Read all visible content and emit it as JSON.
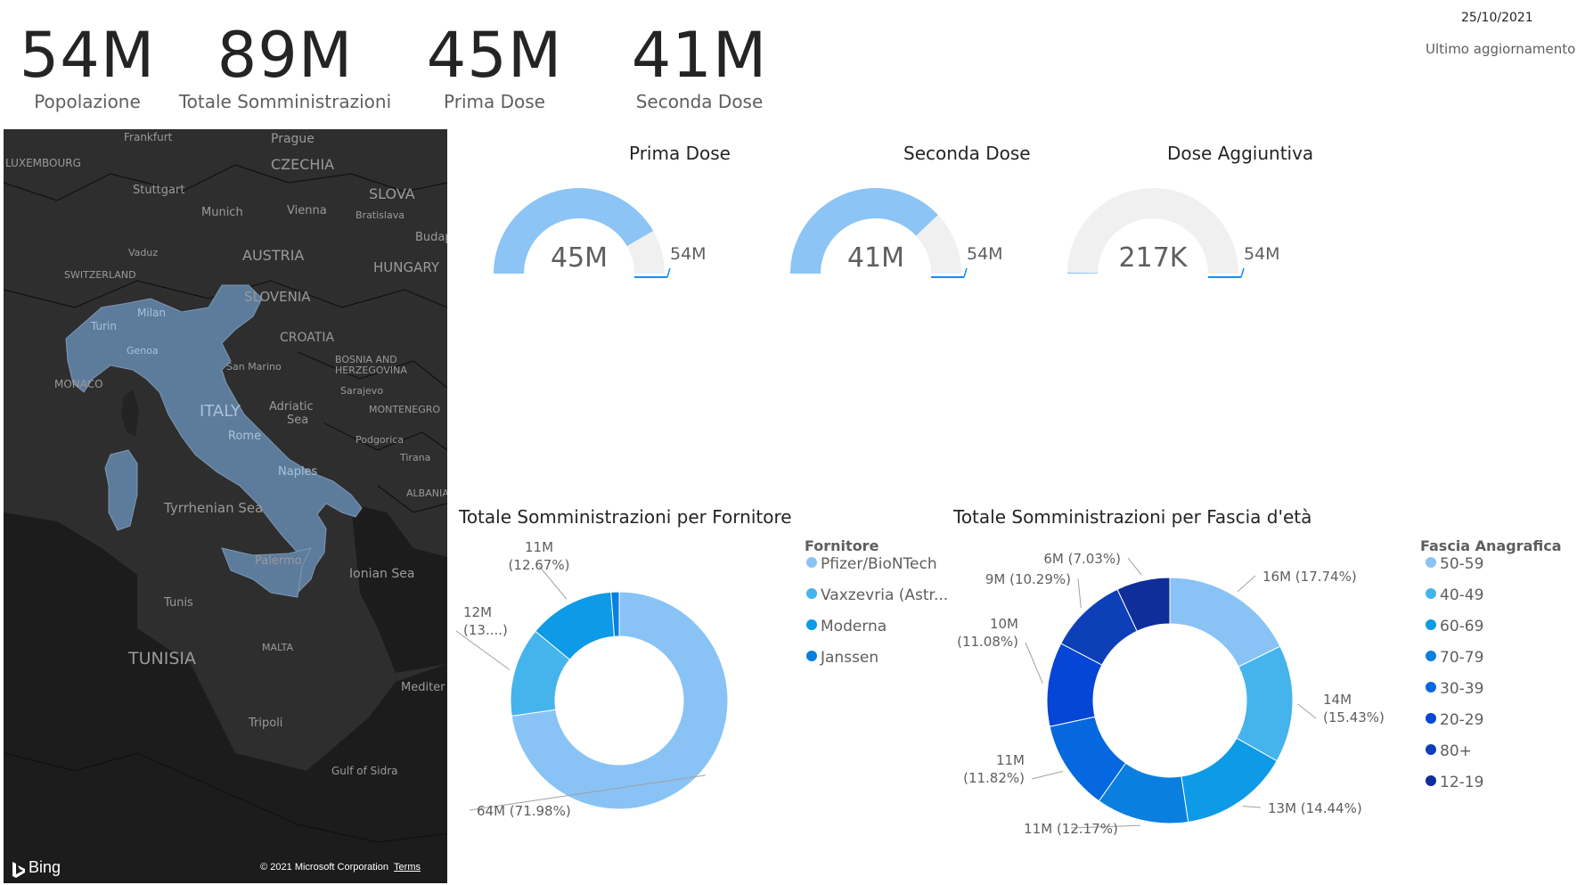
{
  "kpis": [
    {
      "value": "54M",
      "label": "Popolazione"
    },
    {
      "value": "89M",
      "label": "Totale Somministrazioni"
    },
    {
      "value": "45M",
      "label": "Prima Dose"
    },
    {
      "value": "41M",
      "label": "Seconda Dose"
    }
  ],
  "update": {
    "date": "25/10/2021",
    "label": "Ultimo aggiornamento"
  },
  "map": {
    "labels": [
      "Frankfurt",
      "Prague",
      "LUXEMBOURG",
      "CZECHIA",
      "Stuttgart",
      "SLOVA",
      "Munich",
      "Vienna",
      "Bratislava",
      "Budap",
      "Vaduz",
      "AUSTRIA",
      "HUNGARY",
      "SWITZERLAND",
      "SLOVENIA",
      "Milan",
      "Turin",
      "CROATIA",
      "Genoa",
      "San Marino",
      "BOSNIA AND",
      "HERZEGOVINA",
      "MONACO",
      "Sarajevo",
      "ITALY",
      "Adriatic",
      "Sea",
      "MONTENEGRO",
      "Rome",
      "Podgorica",
      "Tirana",
      "Naples",
      "ALBANIA",
      "Tyrrhenian Sea",
      "Palermo",
      "Ionian Sea",
      "Tunis",
      "MALTA",
      "TUNISIA",
      "Mediter",
      "Tripoli",
      "Gulf of Sidra"
    ],
    "bing": "Bing",
    "copyright": "© 2021 Microsoft Corporation",
    "terms": "Terms"
  },
  "gauges": [
    {
      "title": "Prima Dose",
      "value_label": "45M",
      "max_label": "54M",
      "value": 45,
      "max": 54
    },
    {
      "title": "Seconda Dose",
      "value_label": "41M",
      "max_label": "54M",
      "value": 41,
      "max": 54
    },
    {
      "title": "Dose Aggiuntiva",
      "value_label": "217K",
      "max_label": "54M",
      "value": 0.217,
      "max": 54
    }
  ],
  "chart_data": [
    {
      "type": "pie",
      "title": "Totale Somministrazioni per Fornitore",
      "legend_title": "Fornitore",
      "categories": [
        "Pfizer/BioNTech",
        "Vaxzevria (Astr...",
        "Moderna",
        "Janssen"
      ],
      "values": [
        71.98,
        13.12,
        12.67,
        1.2
      ],
      "data_labels": [
        "64M (71.98%)",
        "12M (13....)",
        "11M (12.67%)",
        ""
      ],
      "colors": [
        "#89c3f5",
        "#45b4ed",
        "#0d9ae6",
        "#0a7fe0"
      ]
    },
    {
      "type": "pie",
      "title": "Totale Somministrazioni per Fascia d'età",
      "legend_title": "Fascia Anagrafica",
      "categories": [
        "50-59",
        "40-49",
        "60-69",
        "70-79",
        "30-39",
        "20-29",
        "80+",
        "12-19"
      ],
      "values": [
        17.74,
        15.43,
        14.44,
        12.17,
        11.82,
        11.08,
        10.29,
        7.03
      ],
      "data_labels": [
        "16M (17.74%)",
        "14M (15.43%)",
        "13M (14.44%)",
        "11M (12.17%)",
        "11M (11.82%)",
        "10M (11.08%)",
        "9M (10.29%)",
        "6M (7.03%)"
      ],
      "colors": [
        "#89c3f5",
        "#45b4ed",
        "#0d9ae6",
        "#0a7fe0",
        "#0568e0",
        "#0546d6",
        "#0d3fb8",
        "#0f2e9a"
      ]
    }
  ]
}
